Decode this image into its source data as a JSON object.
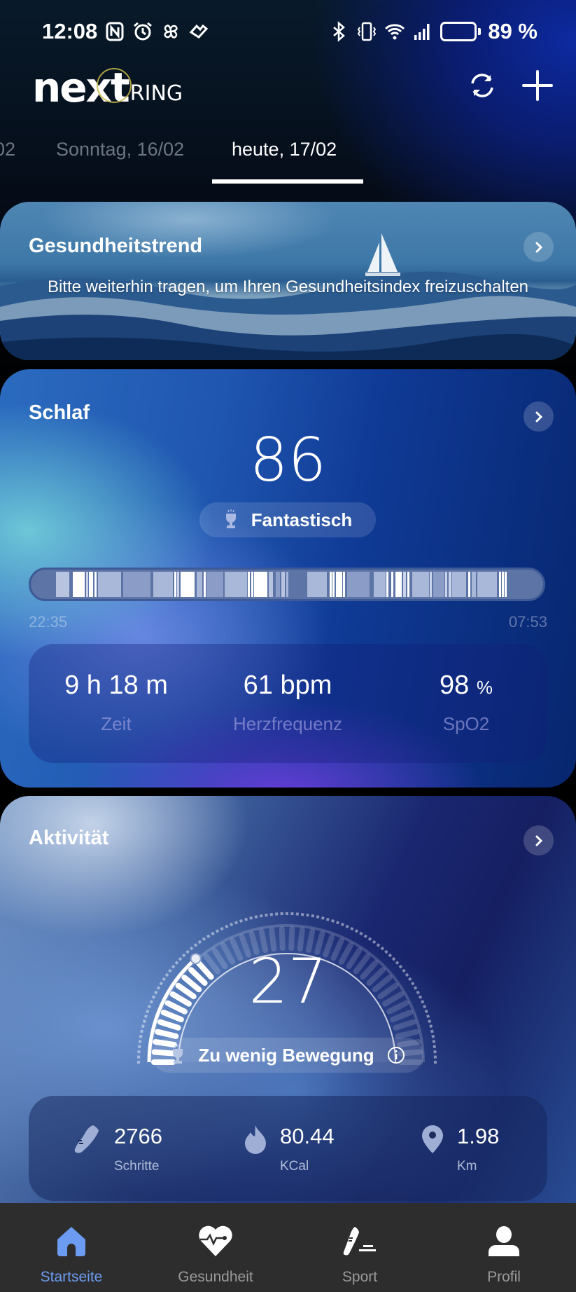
{
  "status_bar": {
    "time": "12:08",
    "left_icons": [
      "nfc-icon",
      "alarm-icon",
      "fan-icon",
      "health-app-icon"
    ],
    "right_icons": [
      "bluetooth-icon",
      "vibrate-icon",
      "wifi-icon",
      "signal-icon"
    ],
    "battery_percent": 89,
    "battery_label": "89 %"
  },
  "header": {
    "logo_text": "nextRING",
    "logo_main": "next",
    "logo_suffix": "RING",
    "sync_icon": "sync-icon",
    "add_icon": "plus-icon"
  },
  "date_tabs": {
    "items": [
      {
        "label": "02",
        "active": false
      },
      {
        "label": "Sonntag, 16/02",
        "active": false
      },
      {
        "label": "heute, 17/02",
        "active": true
      }
    ]
  },
  "health_trend": {
    "title": "Gesundheitstrend",
    "subtitle": "Bitte weiterhin tragen, um Ihren Gesundheitsindex freizuschalten"
  },
  "sleep": {
    "title": "Schlaf",
    "score": "86",
    "rating": "Fantastisch",
    "start_time": "22:35",
    "end_time": "07:53",
    "stats": [
      {
        "value": "9 h 18 m",
        "unit": "",
        "label": "Zeit"
      },
      {
        "value": "61 bpm",
        "unit": "",
        "label": "Herzfrequenz"
      },
      {
        "value": "98",
        "unit": "%",
        "label": "SpO2"
      }
    ]
  },
  "activity": {
    "title": "Aktivität",
    "score": "27",
    "score_fraction": 0.27,
    "rating": "Zu wenig Bewegung",
    "stats": [
      {
        "icon": "shoe-icon",
        "value": "2766",
        "label": "Schritte"
      },
      {
        "icon": "flame-icon",
        "value": "80.44",
        "label": "KCal"
      },
      {
        "icon": "location-pin-icon",
        "value": "1.98",
        "label": "Km"
      }
    ]
  },
  "bottom_nav": {
    "items": [
      {
        "label": "Startseite",
        "icon": "home-icon",
        "active": true
      },
      {
        "label": "Gesundheit",
        "icon": "heart-pulse-icon",
        "active": false
      },
      {
        "label": "Sport",
        "icon": "sneaker-icon",
        "active": false
      },
      {
        "label": "Profil",
        "icon": "person-icon",
        "active": false
      }
    ]
  },
  "colors": {
    "accent": "#6b9cf2",
    "nav_bg": "#2d2d2d",
    "inactive_tab": "#6b7680"
  }
}
